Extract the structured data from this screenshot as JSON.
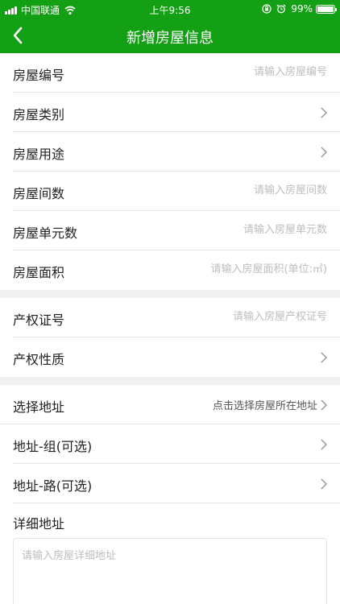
{
  "status_bar": {
    "carrier": "中国联通",
    "time": "上午9:56",
    "battery": "99%",
    "battery_level": 0.99
  },
  "nav": {
    "title": "新增房屋信息",
    "back_icon": "back-arrow-icon"
  },
  "section1": [
    {
      "label": "房屋编号",
      "placeholder": "请输入房屋编号",
      "kind": "input"
    },
    {
      "label": "房屋类别",
      "kind": "select"
    },
    {
      "label": "房屋用途",
      "kind": "select"
    },
    {
      "label": "房屋间数",
      "placeholder": "请输入房屋间数",
      "kind": "input"
    },
    {
      "label": "房屋单元数",
      "placeholder": "请输入房屋单元数",
      "kind": "input"
    },
    {
      "label": "房屋面积",
      "placeholder": "请输入房屋面积(单位:㎡)",
      "kind": "input"
    }
  ],
  "section2": [
    {
      "label": "产权证号",
      "placeholder": "请输入房屋产权证号",
      "kind": "input"
    },
    {
      "label": "产权性质",
      "kind": "select"
    }
  ],
  "section3": [
    {
      "label": "选择地址",
      "hint": "点击选择房屋所在地址",
      "kind": "select"
    },
    {
      "label": "地址-组(可选)",
      "kind": "select"
    },
    {
      "label": "地址-路(可选)",
      "kind": "select"
    }
  ],
  "detail": {
    "label": "详细地址",
    "placeholder": "请输入房屋详细地址"
  },
  "colors": {
    "primary": "#14a014",
    "divider": "#e6e6e6",
    "section_gap": "#f1f1f1",
    "placeholder": "#bdbdbd"
  }
}
